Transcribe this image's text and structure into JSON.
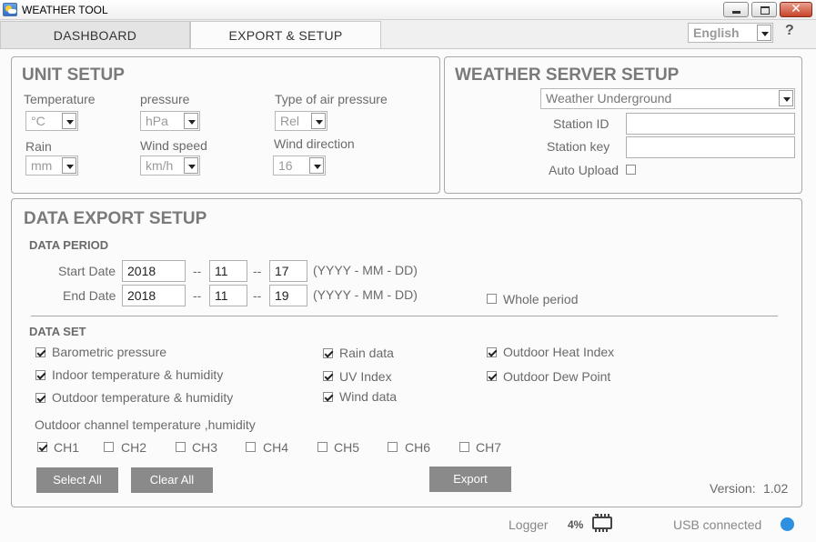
{
  "window": {
    "title": "WEATHER TOOL",
    "close_glyph": "✕"
  },
  "tabs": {
    "dashboard": "DASHBOARD",
    "export_setup": "EXPORT & SETUP"
  },
  "language": {
    "selected": "English"
  },
  "help": {
    "label": "?"
  },
  "unit_setup": {
    "title": "UNIT SETUP",
    "temperature": {
      "label": "Temperature",
      "value": "°C"
    },
    "pressure": {
      "label": "pressure",
      "value": "hPa"
    },
    "air_pressure_type": {
      "label": "Type of air pressure",
      "value": "Rel"
    },
    "rain": {
      "label": "Rain",
      "value": "mm"
    },
    "wind_speed": {
      "label": "Wind speed",
      "value": "km/h"
    },
    "wind_direction": {
      "label": "Wind direction",
      "value": "16"
    }
  },
  "server_setup": {
    "title": "WEATHER SERVER SETUP",
    "service": "Weather Underground",
    "station_id_label": "Station ID",
    "station_id_value": "",
    "station_key_label": "Station key",
    "station_key_value": "",
    "auto_upload_label": "Auto Upload",
    "auto_upload_checked": false
  },
  "data_export": {
    "title": "DATA EXPORT SETUP",
    "period_title": "DATA PERIOD",
    "start_label": "Start Date",
    "start": {
      "year": "2018",
      "month": "11",
      "day": "17"
    },
    "end_label": "End Date",
    "end": {
      "year": "2018",
      "month": "11",
      "day": "19"
    },
    "separator": "--",
    "format_hint": "(YYYY - MM - DD)",
    "whole_period_label": "Whole period",
    "whole_period_checked": false,
    "dataset_title": "DATA SET",
    "dataset": [
      {
        "label": "Barometric pressure",
        "checked": true
      },
      {
        "label": "Indoor temperature & humidity",
        "checked": true
      },
      {
        "label": "Outdoor temperature & humidity",
        "checked": true
      },
      {
        "label": "Rain data",
        "checked": true
      },
      {
        "label": "UV Index",
        "checked": true
      },
      {
        "label": "Wind data",
        "checked": true
      },
      {
        "label": "Outdoor Heat Index",
        "checked": true
      },
      {
        "label": "Outdoor Dew Point",
        "checked": true
      }
    ],
    "channels_title": "Outdoor channel temperature ,humidity",
    "channels": [
      {
        "label": "CH1",
        "checked": true
      },
      {
        "label": "CH2",
        "checked": false
      },
      {
        "label": "CH3",
        "checked": false
      },
      {
        "label": "CH4",
        "checked": false
      },
      {
        "label": "CH5",
        "checked": false
      },
      {
        "label": "CH6",
        "checked": false
      },
      {
        "label": "CH7",
        "checked": false
      }
    ],
    "select_all": "Select All",
    "clear_all": "Clear All",
    "export": "Export",
    "version_label": "Version:",
    "version_value": "1.02"
  },
  "status": {
    "logger_label": "Logger",
    "logger_value": "4%",
    "usb": "USB connected"
  }
}
